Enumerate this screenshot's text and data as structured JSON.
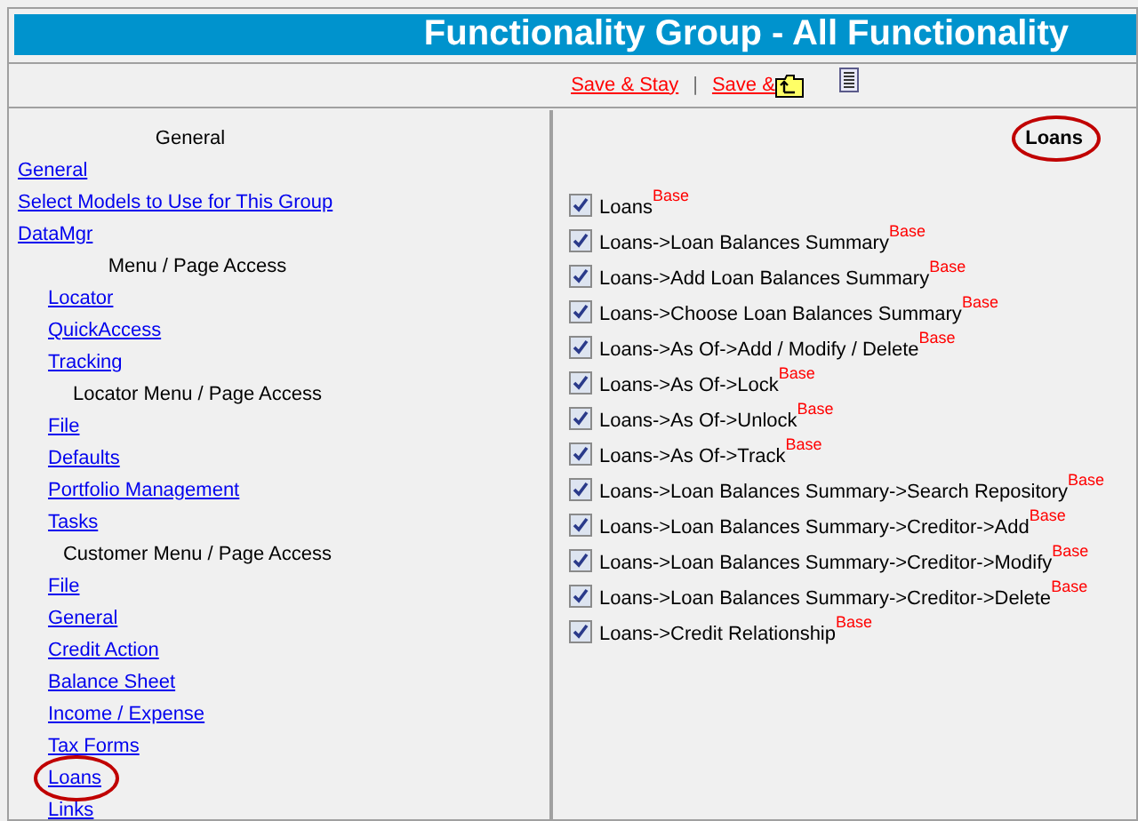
{
  "window": {
    "title": "Functionality Group - All Functionality"
  },
  "toolbar": {
    "links": [
      "Save & Stay",
      "Save &"
    ],
    "separator": "|"
  },
  "sidebar": {
    "title": "General",
    "items": [
      {
        "label": "General",
        "circled": false
      },
      {
        "label": "Select Models to Use for This Group",
        "circled": false
      },
      {
        "label": "DataMgr",
        "circled": false
      }
    ],
    "sections": [
      {
        "heading": "Menu / Page Access",
        "children": [
          {
            "label": "Locator",
            "circled": false
          },
          {
            "label": "QuickAccess",
            "circled": false
          },
          {
            "label": "Tracking",
            "circled": false
          }
        ]
      },
      {
        "heading": "Locator Menu / Page Access",
        "children": [
          {
            "label": "File",
            "circled": false
          },
          {
            "label": "Defaults",
            "circled": false
          },
          {
            "label": "Portfolio Management",
            "circled": false
          },
          {
            "label": "Tasks",
            "circled": false
          }
        ]
      },
      {
        "heading": "Customer Menu / Page Access",
        "children": [
          {
            "label": "File",
            "circled": false
          },
          {
            "label": "General",
            "circled": false
          },
          {
            "label": "Credit Action",
            "circled": false
          },
          {
            "label": "Balance Sheet",
            "circled": false
          },
          {
            "label": "Income / Expense",
            "circled": false
          },
          {
            "label": "Tax Forms",
            "circled": false
          },
          {
            "label": "Loans",
            "circled": true
          },
          {
            "label": "Links",
            "circled": false
          }
        ]
      }
    ]
  },
  "panel": {
    "title": "Loans",
    "circled": true,
    "permissions": [
      {
        "label": "Loans",
        "badge": "Base",
        "checked": true
      },
      {
        "label": "Loans->Loan Balances Summary",
        "badge": "Base",
        "checked": true
      },
      {
        "label": "Loans->Add Loan Balances Summary",
        "badge": "Base",
        "checked": true
      },
      {
        "label": "Loans->Choose Loan Balances Summary",
        "badge": "Base",
        "checked": true
      },
      {
        "label": "Loans->As Of->Add / Modify / Delete",
        "badge": "Base",
        "checked": true
      },
      {
        "label": "Loans->As Of->Lock",
        "badge": "Base",
        "checked": true
      },
      {
        "label": "Loans->As Of->Unlock",
        "badge": "Base",
        "checked": true
      },
      {
        "label": "Loans->As Of->Track",
        "badge": "Base",
        "checked": true
      },
      {
        "label": "Loans->Loan Balances Summary->Search Repository",
        "badge": "Base",
        "checked": true
      },
      {
        "label": "Loans->Loan Balances Summary->Creditor->Add",
        "badge": "Base",
        "checked": true
      },
      {
        "label": "Loans->Loan Balances Summary->Creditor->Modify",
        "badge": "Base",
        "checked": true
      },
      {
        "label": "Loans->Loan Balances Summary->Creditor->Delete",
        "badge": "Base",
        "checked": true
      },
      {
        "label": "Loans->Credit Relationship",
        "badge": "Base",
        "checked": true
      }
    ]
  }
}
